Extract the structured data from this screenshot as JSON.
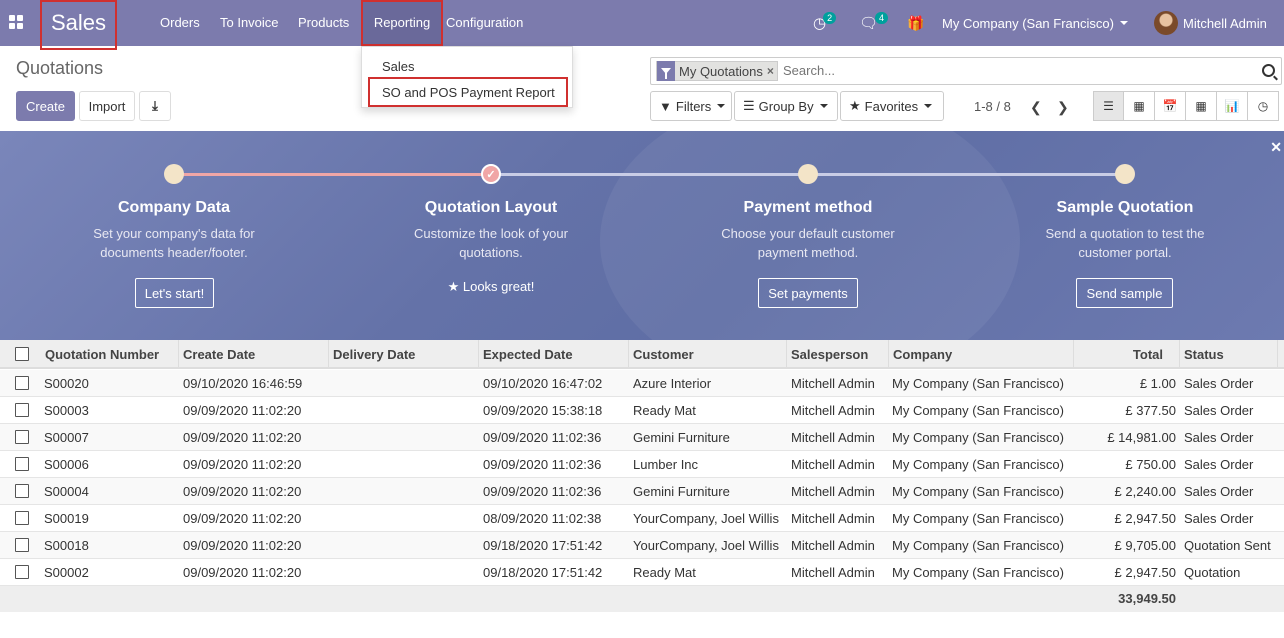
{
  "nav": {
    "brand": "Sales",
    "menu": [
      "Orders",
      "To Invoice",
      "Products",
      "Reporting",
      "Configuration"
    ],
    "activity_count": "2",
    "messages_count": "4",
    "company": "My Company (San Francisco)",
    "user": "Mitchell Admin"
  },
  "reporting_dropdown": {
    "items": [
      "Sales",
      "SO and POS Payment Report"
    ]
  },
  "control": {
    "breadcrumb": "Quotations",
    "create_label": "Create",
    "import_label": "Import",
    "facet_label": "My Quotations",
    "search_placeholder": "Search...",
    "filters_label": "Filters",
    "group_by_label": "Group By",
    "favorites_label": "Favorites",
    "pager": "1-8 / 8",
    "views": [
      "list-icon",
      "kanban-icon",
      "calendar-icon",
      "pivot-icon",
      "graph-icon",
      "activity-icon"
    ]
  },
  "onboarding": {
    "steps": [
      {
        "title": "Company Data",
        "desc": "Set your company's data for documents header/footer.",
        "button": "Let's start!"
      },
      {
        "title": "Quotation Layout",
        "desc": "Customize the look of your quotations.",
        "done_text": "Looks great!"
      },
      {
        "title": "Payment method",
        "desc": "Choose your default customer payment method.",
        "button": "Set payments"
      },
      {
        "title": "Sample Quotation",
        "desc": "Send a quotation to test the customer portal.",
        "button": "Send sample"
      }
    ]
  },
  "table": {
    "columns": [
      "Quotation Number",
      "Create Date",
      "Delivery Date",
      "Expected Date",
      "Customer",
      "Salesperson",
      "Company",
      "Total",
      "Status"
    ],
    "rows": [
      {
        "number": "S00020",
        "create": "09/10/2020 16:46:59",
        "delivery": "",
        "expected": "09/10/2020 16:47:02",
        "customer": "Azure Interior",
        "salesperson": "Mitchell Admin",
        "company": "My Company (San Francisco)",
        "total": "£ 1.00",
        "status": "Sales Order"
      },
      {
        "number": "S00003",
        "create": "09/09/2020 11:02:20",
        "delivery": "",
        "expected": "09/09/2020 15:38:18",
        "customer": "Ready Mat",
        "salesperson": "Mitchell Admin",
        "company": "My Company (San Francisco)",
        "total": "£ 377.50",
        "status": "Sales Order"
      },
      {
        "number": "S00007",
        "create": "09/09/2020 11:02:20",
        "delivery": "",
        "expected": "09/09/2020 11:02:36",
        "customer": "Gemini Furniture",
        "salesperson": "Mitchell Admin",
        "company": "My Company (San Francisco)",
        "total": "£ 14,981.00",
        "status": "Sales Order"
      },
      {
        "number": "S00006",
        "create": "09/09/2020 11:02:20",
        "delivery": "",
        "expected": "09/09/2020 11:02:36",
        "customer": "Lumber Inc",
        "salesperson": "Mitchell Admin",
        "company": "My Company (San Francisco)",
        "total": "£ 750.00",
        "status": "Sales Order"
      },
      {
        "number": "S00004",
        "create": "09/09/2020 11:02:20",
        "delivery": "",
        "expected": "09/09/2020 11:02:36",
        "customer": "Gemini Furniture",
        "salesperson": "Mitchell Admin",
        "company": "My Company (San Francisco)",
        "total": "£ 2,240.00",
        "status": "Sales Order"
      },
      {
        "number": "S00019",
        "create": "09/09/2020 11:02:20",
        "delivery": "",
        "expected": "08/09/2020 11:02:38",
        "customer": "YourCompany, Joel Willis",
        "salesperson": "Mitchell Admin",
        "company": "My Company (San Francisco)",
        "total": "£ 2,947.50",
        "status": "Sales Order"
      },
      {
        "number": "S00018",
        "create": "09/09/2020 11:02:20",
        "delivery": "",
        "expected": "09/18/2020 17:51:42",
        "customer": "YourCompany, Joel Willis",
        "salesperson": "Mitchell Admin",
        "company": "My Company (San Francisco)",
        "total": "£ 9,705.00",
        "status": "Quotation Sent"
      },
      {
        "number": "S00002",
        "create": "09/09/2020 11:02:20",
        "delivery": "",
        "expected": "09/18/2020 17:51:42",
        "customer": "Ready Mat",
        "salesperson": "Mitchell Admin",
        "company": "My Company (San Francisco)",
        "total": "£ 2,947.50",
        "status": "Quotation"
      }
    ],
    "footer_total": "33,949.50"
  },
  "colors": {
    "brand": "#7c7bad",
    "highlight_border": "#d0302f",
    "badge": "#00a09d"
  }
}
